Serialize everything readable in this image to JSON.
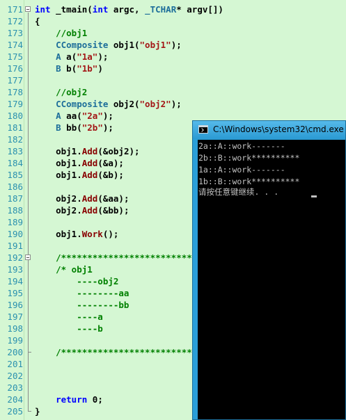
{
  "editor": {
    "lines": [
      {
        "num": "171",
        "tokens": [
          {
            "t": "int ",
            "c": "kw"
          },
          {
            "t": "_tmain(",
            "c": "pl"
          },
          {
            "t": "int ",
            "c": "kw"
          },
          {
            "t": "argc, ",
            "c": "pl"
          },
          {
            "t": "_TCHAR",
            "c": "ty"
          },
          {
            "t": "* argv[])",
            "c": "pl"
          }
        ]
      },
      {
        "num": "172",
        "tokens": [
          {
            "t": "{",
            "c": "pl"
          }
        ]
      },
      {
        "num": "173",
        "tokens": [
          {
            "t": "    //obj1",
            "c": "cm"
          }
        ]
      },
      {
        "num": "174",
        "tokens": [
          {
            "t": "    ",
            "c": "pl"
          },
          {
            "t": "CComposite",
            "c": "ty"
          },
          {
            "t": " obj1(",
            "c": "pl"
          },
          {
            "t": "\"obj1\"",
            "c": "str"
          },
          {
            "t": ");",
            "c": "pl"
          }
        ]
      },
      {
        "num": "175",
        "tokens": [
          {
            "t": "    ",
            "c": "pl"
          },
          {
            "t": "A",
            "c": "ty"
          },
          {
            "t": " a(",
            "c": "pl"
          },
          {
            "t": "\"1a\"",
            "c": "str"
          },
          {
            "t": ");",
            "c": "pl"
          }
        ]
      },
      {
        "num": "176",
        "tokens": [
          {
            "t": "    ",
            "c": "pl"
          },
          {
            "t": "B",
            "c": "ty"
          },
          {
            "t": " b(",
            "c": "pl"
          },
          {
            "t": "\"1b\"",
            "c": "str"
          },
          {
            "t": ")",
            "c": "pl"
          }
        ]
      },
      {
        "num": "177",
        "tokens": []
      },
      {
        "num": "178",
        "tokens": [
          {
            "t": "    //obj2",
            "c": "cm"
          }
        ]
      },
      {
        "num": "179",
        "tokens": [
          {
            "t": "    ",
            "c": "pl"
          },
          {
            "t": "CComposite",
            "c": "ty"
          },
          {
            "t": " obj2(",
            "c": "pl"
          },
          {
            "t": "\"obj2\"",
            "c": "str"
          },
          {
            "t": ");",
            "c": "pl"
          }
        ]
      },
      {
        "num": "180",
        "tokens": [
          {
            "t": "    ",
            "c": "pl"
          },
          {
            "t": "A",
            "c": "ty"
          },
          {
            "t": " aa(",
            "c": "pl"
          },
          {
            "t": "\"2a\"",
            "c": "str"
          },
          {
            "t": ");",
            "c": "pl"
          }
        ]
      },
      {
        "num": "181",
        "tokens": [
          {
            "t": "    ",
            "c": "pl"
          },
          {
            "t": "B",
            "c": "ty"
          },
          {
            "t": " bb(",
            "c": "pl"
          },
          {
            "t": "\"2b\"",
            "c": "str"
          },
          {
            "t": ");",
            "c": "pl"
          }
        ]
      },
      {
        "num": "182",
        "tokens": []
      },
      {
        "num": "183",
        "tokens": [
          {
            "t": "    obj1.",
            "c": "pl"
          },
          {
            "t": "Add",
            "c": "fn"
          },
          {
            "t": "(&obj2);",
            "c": "pl"
          }
        ]
      },
      {
        "num": "184",
        "tokens": [
          {
            "t": "    obj1.",
            "c": "pl"
          },
          {
            "t": "Add",
            "c": "fn"
          },
          {
            "t": "(&a);",
            "c": "pl"
          }
        ]
      },
      {
        "num": "185",
        "tokens": [
          {
            "t": "    obj1.",
            "c": "pl"
          },
          {
            "t": "Add",
            "c": "fn"
          },
          {
            "t": "(&b);",
            "c": "pl"
          }
        ]
      },
      {
        "num": "186",
        "tokens": []
      },
      {
        "num": "187",
        "tokens": [
          {
            "t": "    obj2.",
            "c": "pl"
          },
          {
            "t": "Add",
            "c": "fn"
          },
          {
            "t": "(&aa);",
            "c": "pl"
          }
        ]
      },
      {
        "num": "188",
        "tokens": [
          {
            "t": "    obj2.",
            "c": "pl"
          },
          {
            "t": "Add",
            "c": "fn"
          },
          {
            "t": "(&bb);",
            "c": "pl"
          }
        ]
      },
      {
        "num": "189",
        "tokens": []
      },
      {
        "num": "190",
        "tokens": [
          {
            "t": "    obj1.",
            "c": "pl"
          },
          {
            "t": "Work",
            "c": "fn"
          },
          {
            "t": "();",
            "c": "pl"
          }
        ]
      },
      {
        "num": "191",
        "tokens": []
      },
      {
        "num": "192",
        "tokens": [
          {
            "t": "    /*****************************",
            "c": "cm"
          }
        ]
      },
      {
        "num": "193",
        "tokens": [
          {
            "t": "    /* obj1",
            "c": "cm"
          }
        ]
      },
      {
        "num": "194",
        "tokens": [
          {
            "t": "        ----obj2",
            "c": "cm"
          }
        ]
      },
      {
        "num": "195",
        "tokens": [
          {
            "t": "        --------aa",
            "c": "cm"
          }
        ]
      },
      {
        "num": "196",
        "tokens": [
          {
            "t": "        --------bb",
            "c": "cm"
          }
        ]
      },
      {
        "num": "197",
        "tokens": [
          {
            "t": "        ----a",
            "c": "cm"
          }
        ]
      },
      {
        "num": "198",
        "tokens": [
          {
            "t": "        ----b",
            "c": "cm"
          }
        ]
      },
      {
        "num": "199",
        "tokens": []
      },
      {
        "num": "200",
        "tokens": [
          {
            "t": "    /*****************************",
            "c": "cm"
          }
        ]
      },
      {
        "num": "201",
        "tokens": []
      },
      {
        "num": "202",
        "tokens": []
      },
      {
        "num": "203",
        "tokens": []
      },
      {
        "num": "204",
        "tokens": [
          {
            "t": "    ",
            "c": "pl"
          },
          {
            "t": "return",
            "c": "kw"
          },
          {
            "t": " 0;",
            "c": "pl"
          }
        ]
      },
      {
        "num": "205",
        "tokens": [
          {
            "t": "}",
            "c": "pl"
          }
        ]
      }
    ]
  },
  "console": {
    "title": "C:\\Windows\\system32\\cmd.exe",
    "icon": "console-icon",
    "lines": [
      "2a::A::work-------",
      "2b::B::work**********",
      "1a::A::work-------",
      "1b::B::work**********",
      "请按任意键继续. . . "
    ]
  }
}
